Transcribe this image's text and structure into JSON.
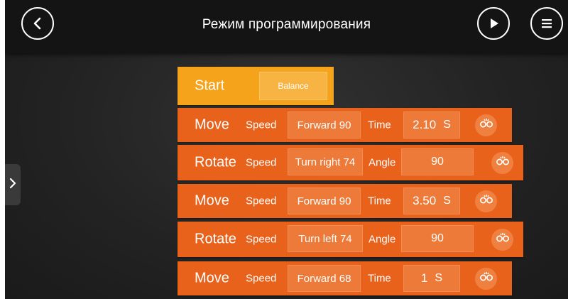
{
  "header": {
    "title": "Режим программирования"
  },
  "start_block": {
    "label": "Start",
    "mode": "Balance"
  },
  "labels": {
    "speed": "Speed",
    "time": "Time",
    "angle": "Angle"
  },
  "blocks": [
    {
      "type": "Move",
      "speed": "Forward 90",
      "param": "Time",
      "value": "2.10",
      "unit": "S"
    },
    {
      "type": "Rotate",
      "speed": "Turn right 74",
      "param": "Angle",
      "value": "90",
      "unit": ""
    },
    {
      "type": "Move",
      "speed": "Forward 90",
      "param": "Time",
      "value": "3.50",
      "unit": "S"
    },
    {
      "type": "Rotate",
      "speed": "Turn left 74",
      "param": "Angle",
      "value": "90",
      "unit": ""
    },
    {
      "type": "Move",
      "speed": "Forward 68",
      "param": "Time",
      "value": "1",
      "unit": "S"
    }
  ],
  "colors": {
    "start": "#f5a31a",
    "command": "#e8621c",
    "background": "#232323"
  },
  "icons": {
    "back": "back-chevron-icon",
    "play": "play-icon",
    "menu": "menu-icon",
    "expand": "expand-chevron-icon",
    "block_settings": "robot-face-icon"
  }
}
